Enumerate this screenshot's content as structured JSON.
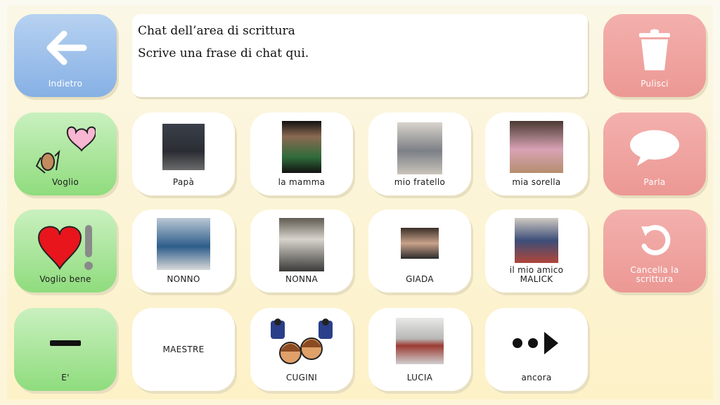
{
  "writing_area": {
    "title": "Chat dell’area di scrittura",
    "placeholder": "Scrive una frase di chat qui."
  },
  "controls": {
    "back_label": "Indietro",
    "clear_label": "Pulisci",
    "speak_label": "Parla",
    "undo_label": "Cancella la scrittura"
  },
  "grid": {
    "want": "Voglio",
    "love": "Voglio bene",
    "is": "E'",
    "dad": "Papà",
    "mom": "la mamma",
    "brother": "mio fratello",
    "sister": "mia sorella",
    "grandpa": "NONNO",
    "grandma": "NONNA",
    "giada": "GIADA",
    "malick": "il mio amico MALICK",
    "teachers": "MAESTRE",
    "cousins": "CUGINI",
    "lucia": "LUCIA",
    "more": "ancora"
  },
  "colors": {
    "green_tile": "#8fdc7d",
    "red_tile": "#ec9894",
    "blue_tile": "#86b0e4"
  }
}
